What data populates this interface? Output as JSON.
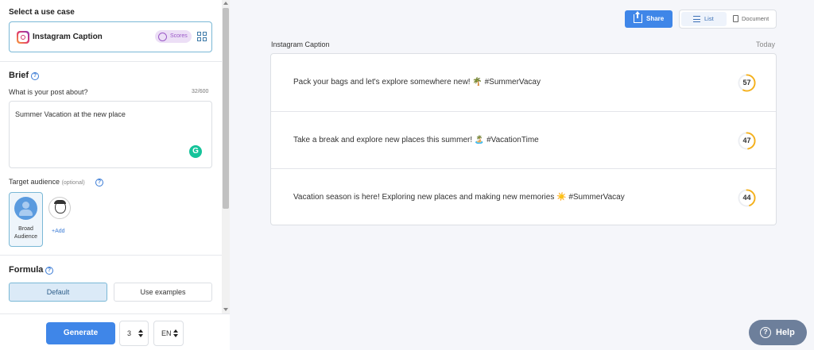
{
  "left_panel": {
    "use_case_label": "Select a use case",
    "use_case": {
      "title": "Instagram Caption",
      "scores_badge": "Scores",
      "icon": "instagram-icon"
    },
    "brief": {
      "heading": "Brief",
      "question": "What is your post about?",
      "char_count": "32/600",
      "value": "Summer Vacation at the new place",
      "grammarly_badge": "G"
    },
    "target_audience": {
      "label": "Target audience",
      "optional": "(optional)",
      "selected_card": "Broad Audience",
      "add_label": "+Add"
    },
    "formula": {
      "heading": "Formula",
      "default_label": "Default",
      "examples_label": "Use examples"
    },
    "bottom": {
      "generate_label": "Generate",
      "count_value": "3",
      "language_value": "EN"
    }
  },
  "toolbar": {
    "share_label": "Share",
    "view_list": "List",
    "view_document": "Document"
  },
  "results": {
    "label": "Instagram Caption",
    "date": "Today",
    "items": [
      {
        "text": "Pack your bags and let's explore somewhere new! 🌴 #SummerVacay",
        "score": 57,
        "score_fraction": 0.57
      },
      {
        "text": "Take a break and explore new places this summer! 🏝️ #VacationTime",
        "score": 47,
        "score_fraction": 0.47
      },
      {
        "text": "Vacation season is here! Exploring new places and making new memories ☀️ #SummerVacay",
        "score": 44,
        "score_fraction": 0.44
      }
    ]
  },
  "help_label": "Help",
  "colors": {
    "primary": "#3f86e8",
    "score_ring": "#f5b01a",
    "selected_border": "#7ab8d6",
    "help_button": "#6d7f9b"
  }
}
